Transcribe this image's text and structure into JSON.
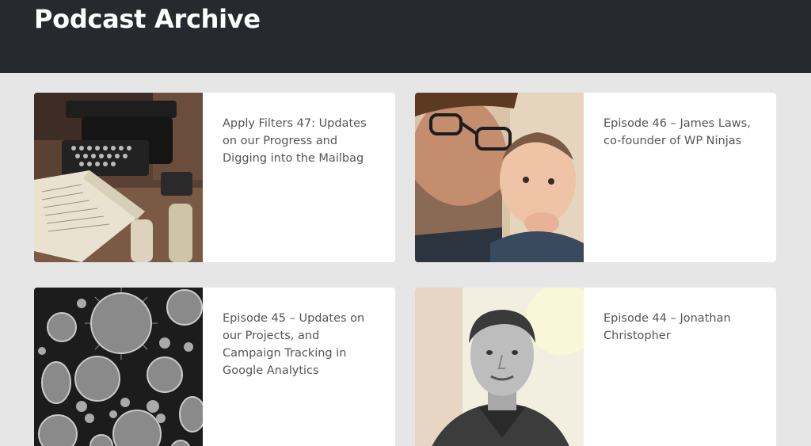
{
  "header": {
    "title": "Podcast Archive",
    "background": "#26292d"
  },
  "episodes": [
    {
      "title": "Apply Filters 47: Updates on our Progress and Digging into the Mailbag",
      "image": "typewriter-and-notebook"
    },
    {
      "title": "Episode 46 – James Laws, co-founder of WP Ninjas",
      "image": "man-with-baby"
    },
    {
      "title": "Episode 45 – Updates on our Projects, and Campaign Tracking in Google Analytics",
      "image": "pollen-grains-microscope"
    },
    {
      "title": "Episode 44 – Jonathan Christopher",
      "image": "man-portrait"
    }
  ],
  "colors": {
    "page_background": "#e6e6e6",
    "card_background": "#ffffff",
    "title_text": "#555555"
  }
}
